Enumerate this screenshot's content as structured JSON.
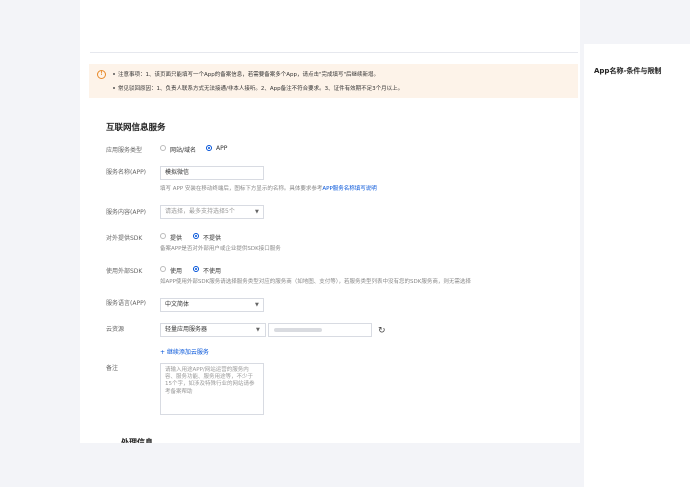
{
  "right_panel": {
    "title": "App名称-条件与限制"
  },
  "notice": {
    "line1": "注意事项：1、该页面只能填写一个App的备案信息，若需要备案多个App，请点击\"完成填写\"后继续新增。",
    "line2": "常见驳回原因：1、负责人联系方式无法接通/非本人接听。2、App备注不符合要求。3、证件有效期不足3个月以上。"
  },
  "section": {
    "title": "互联网信息服务",
    "bottom_title": "处理信息"
  },
  "form": {
    "service_type": {
      "label": "应用服务类型",
      "options": [
        "网站/域名",
        "APP"
      ],
      "selected": "APP"
    },
    "service_name": {
      "label": "服务名称(APP)",
      "value": "模拟微信",
      "hint_text": "填写 APP 安装在移动终端后，图标下方显示的名称。具体要求参考",
      "hint_link": "APP服务名称填写说明"
    },
    "service_content": {
      "label": "服务内容(APP)",
      "placeholder": "请选择，最多支持选择5个"
    },
    "external_sdk": {
      "label": "对外提供SDK",
      "options": [
        "提供",
        "不提供"
      ],
      "selected": "不提供",
      "hint": "备案APP是否对外部用户或企业提供SDK接口服务"
    },
    "use_external_sdk": {
      "label": "使用外部SDK",
      "options": [
        "使用",
        "不使用"
      ],
      "selected": "不使用",
      "hint": "如APP使用外部SDK服务请选择服务类型对应的服务商（如地图、支付等），若服务类型列表中没有您的SDK服务商，则无需选择"
    },
    "language": {
      "label": "服务语言(APP)",
      "value": "中文简体"
    },
    "cloud": {
      "label": "云资源",
      "value": "轻量应用服务器",
      "add_link": "+ 继续添加云服务"
    },
    "remark": {
      "label": "备注",
      "placeholder": "请输入用途APP/网站运营的服务内容、服务功能、服务用途等，不少于15个字，如涉及特殊行业的网站请参考备案帮助"
    }
  },
  "icons": {
    "notice": "info-circle-icon",
    "refresh": "refresh-icon",
    "dropdown": "chevron-down-icon"
  },
  "colors": {
    "accent": "#0052d9",
    "notice_bg": "#fdf3e9",
    "notice_icon": "#e88a2a"
  }
}
